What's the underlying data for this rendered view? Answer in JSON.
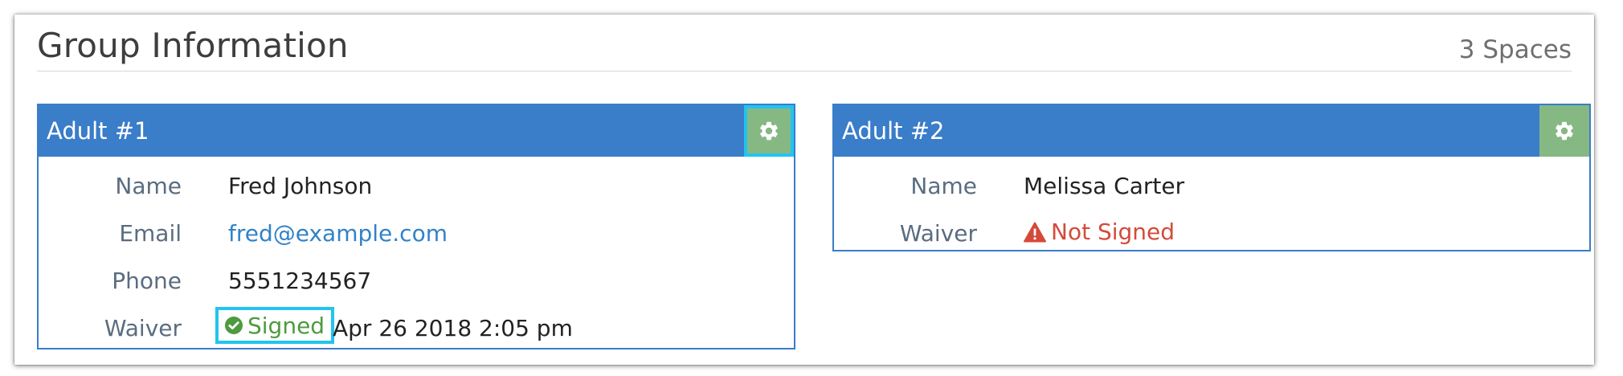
{
  "group": {
    "title": "Group Information",
    "spaces": "3 Spaces"
  },
  "cards": [
    {
      "title": "Adult #1",
      "fields": {
        "name_label": "Name",
        "name_value": "Fred Johnson",
        "email_label": "Email",
        "email_value": "fred@example.com",
        "phone_label": "Phone",
        "phone_value": "5551234567",
        "waiver_label": "Waiver",
        "waiver_status": "Signed",
        "waiver_date": "Apr 26 2018 2:05 pm"
      }
    },
    {
      "title": "Adult #2",
      "fields": {
        "name_label": "Name",
        "name_value": "Melissa Carter",
        "waiver_label": "Waiver",
        "waiver_status": "Not Signed"
      }
    }
  ],
  "icons": {
    "settings": "gear-icon",
    "signed": "check-circle-icon",
    "not_signed": "warning-triangle-icon"
  },
  "colors": {
    "header_blue": "#3a7dc9",
    "gear_green": "#86b884",
    "highlight_cyan": "#22c4ef",
    "signed_green": "#4e9a3e",
    "not_signed_red": "#d44a3a",
    "link_blue": "#3182c8"
  }
}
